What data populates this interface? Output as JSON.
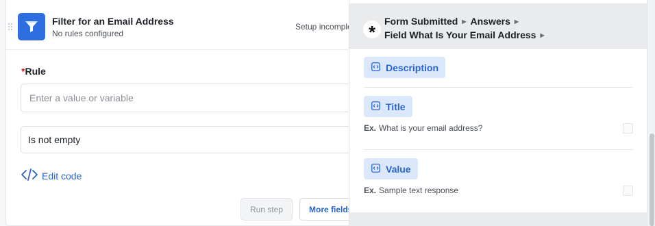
{
  "step": {
    "title": "Filter for an Email Address",
    "subtitle": "No rules configured",
    "status": "Setup incomplete"
  },
  "rule": {
    "label": "Rule",
    "required_mark": "*",
    "value_placeholder": "Enter a value or variable",
    "operator": "Is not empty",
    "edit_code_label": "Edit code"
  },
  "buttons": {
    "run_step": "Run step",
    "more_fields": "More fields"
  },
  "picker": {
    "breadcrumb": [
      "Form Submitted",
      "Answers",
      "Field What Is Your Email Address"
    ],
    "fields": [
      {
        "name": "Description",
        "example": ""
      },
      {
        "name": "Title",
        "example_prefix": "Ex.",
        "example": "What is your email address?"
      },
      {
        "name": "Value",
        "example_prefix": "Ex.",
        "example": "Sample text response"
      }
    ]
  },
  "colors": {
    "accent": "#2a63cc",
    "app_icon": "#2f6ee0",
    "chip_bg": "#dbe8fb",
    "required": "#d62a2a"
  },
  "icons": [
    "drag-handle-icon",
    "filter-funnel-icon",
    "code-brackets-icon",
    "trigger-asterisk-icon",
    "chevron-right-icon",
    "variable-icon"
  ]
}
